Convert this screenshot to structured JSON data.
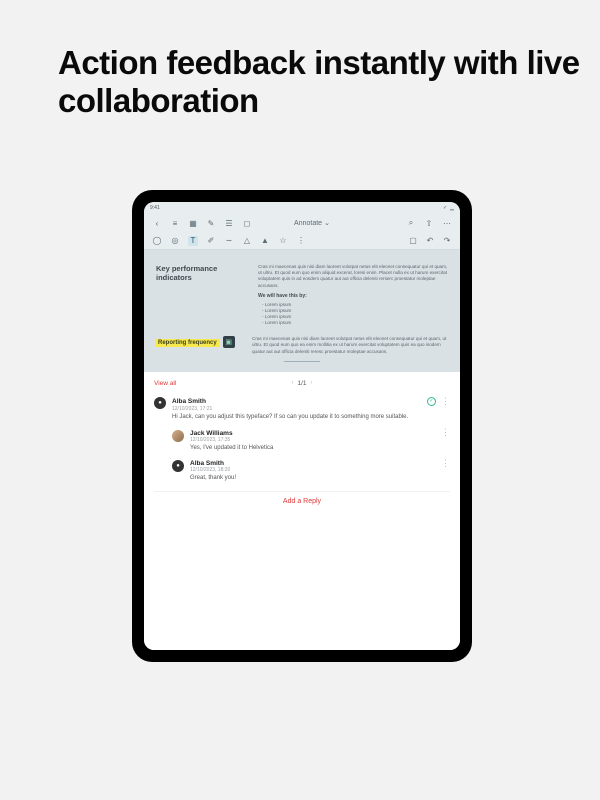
{
  "headline": "Action feedback instantly with live collaboration",
  "status": {
    "time": "9:41"
  },
  "toolbar": {
    "title": "Annotate",
    "back": "‹"
  },
  "document": {
    "heading1": "Key performance indicators",
    "para1": "Cras mi maecenas quis nisi diam laoreet volutpat netus elit eleonet consequatur qui et quam, ut ultru. Et quod eum quo enim aliquid excerat, loresi enim. Placet nulla ex ut harum exercitat voluptatem quis in ad eosdem quatur aut aut officia deleniti rerserc proestatur moleptae accusans.",
    "subhead": "We will have this by:",
    "bullets": [
      "Lorem ipsum",
      "Lorem ipsum",
      "Lorem ipsum",
      "Lorem ipsum"
    ],
    "highlight": "Reporting frequency",
    "para2": "Cras mi maecenas quis nisi diam laoreet volutpat netus elit eleonet consequatur qui et quam, ut ultru. Et quod eum quo ea enim mollitia ex ut harum exercitat voluptatem quis ea quo isodem quatur aut aut officia deleniti reresc proestatur moleptae accusans."
  },
  "panel": {
    "view_all": "View all",
    "page": "1/1",
    "add_reply": "Add a Reply"
  },
  "comments": [
    {
      "name": "Alba Smith",
      "date": "12/10/2023, 17:21",
      "text": "Hi Jack, can you adjust this typeface? If so can you update it to something more suitable."
    },
    {
      "name": "Jack Williams",
      "date": "12/10/2023, 17:35",
      "text": "Yes, I've updated it to Helvetica"
    },
    {
      "name": "Alba Smith",
      "date": "12/10/2023, 18:20",
      "text": "Great, thank you!"
    }
  ]
}
